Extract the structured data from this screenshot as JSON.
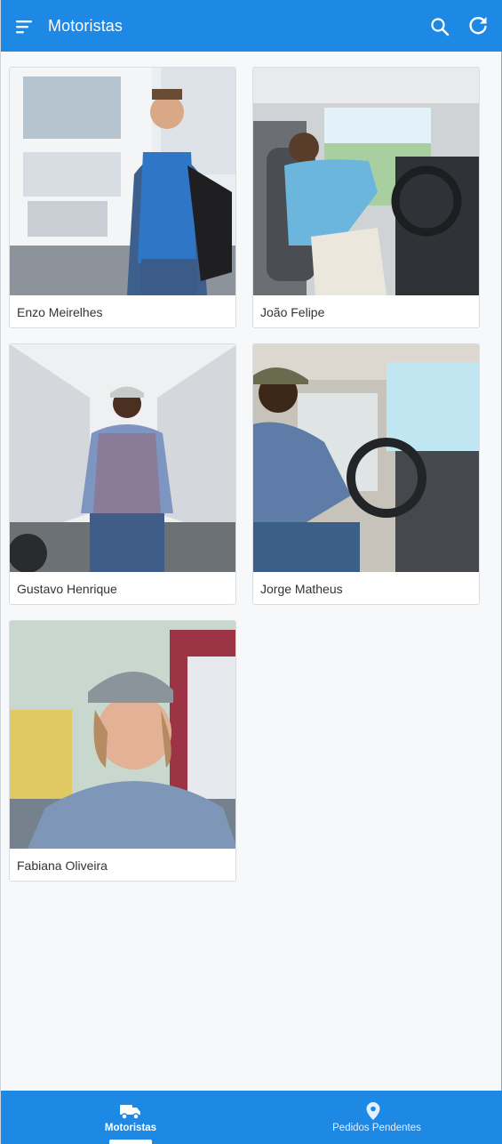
{
  "app": {
    "title": "Motoristas"
  },
  "colors": {
    "primary": "#1e88e5",
    "background": "#f6f8fa",
    "card": "#ffffff",
    "text": "#333333"
  },
  "icons": {
    "menu": "menu-icon",
    "search": "search-icon",
    "refresh": "refresh-icon",
    "truck": "truck-icon",
    "location": "location-pin-icon"
  },
  "drivers": [
    {
      "name": "Enzo Meirelhes"
    },
    {
      "name": "João Felipe"
    },
    {
      "name": "Gustavo Henrique"
    },
    {
      "name": "Jorge Matheus"
    },
    {
      "name": "Fabiana Oliveira"
    }
  ],
  "bottom_nav": {
    "tabs": [
      {
        "label": "Motoristas",
        "active": true
      },
      {
        "label": "Pedidos Pendentes",
        "active": false
      }
    ]
  }
}
